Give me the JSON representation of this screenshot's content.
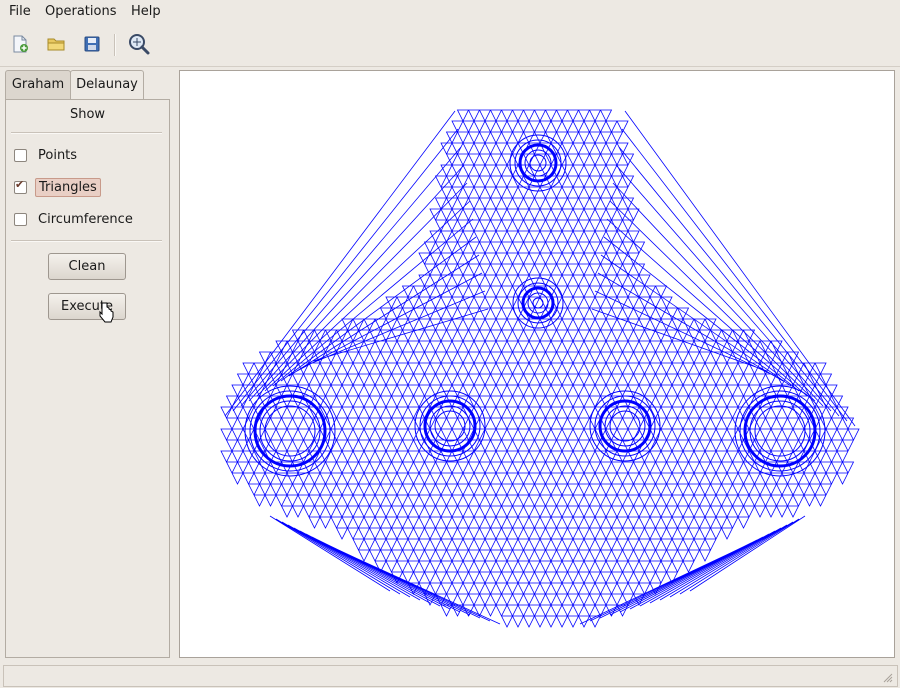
{
  "menubar": {
    "file": "File",
    "operations": "Operations",
    "help": "Help"
  },
  "toolbar": {
    "new_icon": "new-document-icon",
    "open_icon": "folder-open-icon",
    "save_icon": "save-icon",
    "zoom_icon": "zoom-icon"
  },
  "tabs": {
    "graham": "Graham",
    "delaunay": "Delaunay"
  },
  "panel": {
    "show_label": "Show",
    "points": {
      "label": "Points",
      "checked": false
    },
    "triangles": {
      "label": "Triangles",
      "checked": true
    },
    "circumference": {
      "label": "Circumference",
      "checked": false
    },
    "clean_label": "Clean",
    "execute_label": "Execute"
  },
  "canvas": {
    "mesh_color": "#0000ff"
  },
  "colors": {
    "accent": "#0000ff",
    "window_bg": "#ede9e3"
  }
}
